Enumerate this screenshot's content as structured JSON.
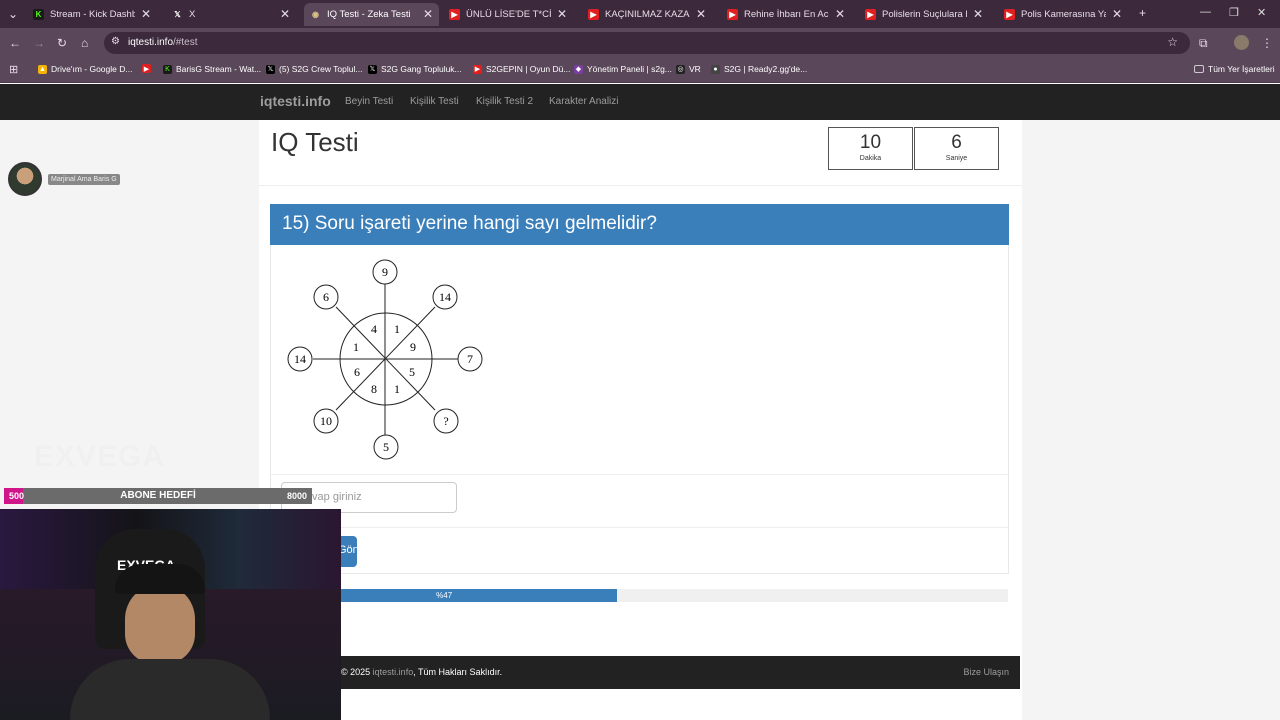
{
  "browser": {
    "tabs": [
      {
        "title": "Stream - Kick Dashboard",
        "icon": "kick-icon",
        "active": false
      },
      {
        "title": "X",
        "icon": "x-icon",
        "active": false
      },
      {
        "title": "IQ Testi - Zeka Testi",
        "icon": "site-icon",
        "active": true
      },
      {
        "title": "ÜNLÜ LİSE'DE T*CİZ İDDİA",
        "icon": "youtube-icon",
        "active": false
      },
      {
        "title": "KAÇINILMAZ KAZA! Türki",
        "icon": "youtube-icon",
        "active": false
      },
      {
        "title": "Rehine İhbarı En Acı Polis",
        "icon": "youtube-icon",
        "active": false
      },
      {
        "title": "Polislerin Suçlulara Karşı",
        "icon": "youtube-icon",
        "active": false
      },
      {
        "title": "Polis Kamerasına Yakalan",
        "icon": "youtube-icon",
        "active": false
      }
    ],
    "new_tab": "+",
    "url_host": "iqtesti.info",
    "url_path": "/#test",
    "bookmarks": [
      {
        "label": "Drive'ım - Google D...",
        "icon": "drive-icon"
      },
      {
        "label": "",
        "icon": "youtube-icon"
      },
      {
        "label": "BarisG Stream - Wat...",
        "icon": "kick-icon"
      },
      {
        "label": "(5) S2G Crew Toplul...",
        "icon": "x-icon"
      },
      {
        "label": "S2G Gang Topluluk...",
        "icon": "x-icon"
      },
      {
        "label": "S2GEPIN | Oyun Dü...",
        "icon": "youtube-icon"
      },
      {
        "label": "Yönetim Paneli | s2g...",
        "icon": "panel-icon"
      },
      {
        "label": "VR",
        "icon": "vr-icon"
      },
      {
        "label": "S2G | Ready2.gg'de...",
        "icon": "globe-icon"
      }
    ],
    "all_bookmarks": "Tüm Yer İşaretleri"
  },
  "site": {
    "brand": "iqtesti.info",
    "nav": [
      "Beyin Testi",
      "Kişilik Testi",
      "Kişilik Testi 2",
      "Karakter Analizi"
    ],
    "page_title": "IQ Testi",
    "timer": {
      "minutes": "10",
      "minutes_label": "Dakika",
      "seconds": "6",
      "seconds_label": "Saniye"
    },
    "question": "15) Soru işareti yerine hangi sayı gelmelidir?",
    "puzzle": {
      "outer": [
        "9",
        "14",
        "7",
        "?",
        "5",
        "10",
        "14",
        "6"
      ],
      "inner": [
        "1",
        "9",
        "5",
        "1",
        "8",
        "6",
        "1",
        "4"
      ]
    },
    "answer_placeholder": "Cevap giriniz",
    "submit_label": "Gönder",
    "progress_label": "%47",
    "progress_value": 0.47,
    "footer_year": "© 2025",
    "footer_brand": "iqtesti.info",
    "footer_rights": "Tüm Hakları Saklıdır.",
    "footer_contact": "Bize Ulaşın"
  },
  "overlay": {
    "streamer_name": "Marjinal Ama Baris G",
    "channel_logo": "EXVEGA",
    "sub_goal": {
      "current": "500",
      "label": "ABONE HEDEFİ",
      "target": "8000",
      "fraction": 0.0625
    },
    "cap_logo": "EXVEGA"
  },
  "colors": {
    "accent": "#3a7fba",
    "nav_bg": "#222222",
    "chrome": "#5a475a",
    "tab_bar": "#3c2a3c",
    "goal_fill": "#d0148a"
  }
}
